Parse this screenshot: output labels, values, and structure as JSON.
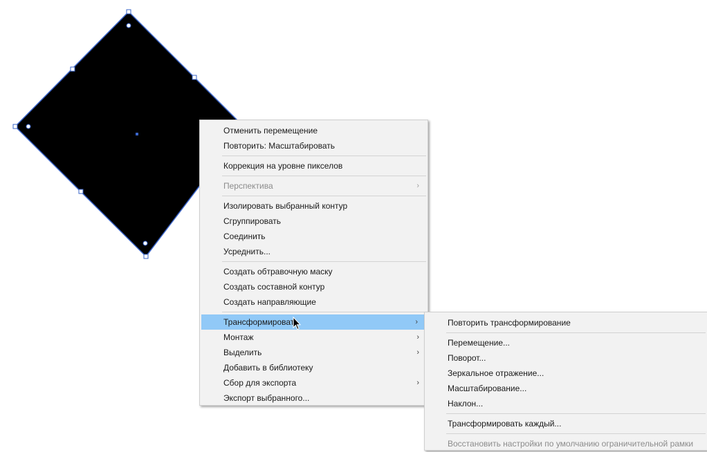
{
  "colors": {
    "artwork_fill": "#000000",
    "selection_stroke": "#3a64c8",
    "menu_background": "#f2f2f2",
    "menu_highlight": "#91c9f7",
    "disabled_text": "#8c8c8c"
  },
  "context_menu": {
    "groups": [
      [
        {
          "label": "Отменить перемещение",
          "enabled": true,
          "submenu": false
        },
        {
          "label": "Повторить: Масштабировать",
          "enabled": true,
          "submenu": false
        }
      ],
      [
        {
          "label": "Коррекция на уровне пикселов",
          "enabled": true,
          "submenu": false
        }
      ],
      [
        {
          "label": "Перспектива",
          "enabled": false,
          "submenu": true
        }
      ],
      [
        {
          "label": "Изолировать выбранный контур",
          "enabled": true,
          "submenu": false
        },
        {
          "label": "Сгруппировать",
          "enabled": true,
          "submenu": false
        },
        {
          "label": "Соединить",
          "enabled": true,
          "submenu": false
        },
        {
          "label": "Усреднить...",
          "enabled": true,
          "submenu": false
        }
      ],
      [
        {
          "label": "Создать обтравочную маску",
          "enabled": true,
          "submenu": false
        },
        {
          "label": "Создать составной контур",
          "enabled": true,
          "submenu": false
        },
        {
          "label": "Создать направляющие",
          "enabled": true,
          "submenu": false
        }
      ],
      [
        {
          "label": "Трансформировать",
          "enabled": true,
          "submenu": true,
          "highlighted": true
        },
        {
          "label": "Монтаж",
          "enabled": true,
          "submenu": true
        },
        {
          "label": "Выделить",
          "enabled": true,
          "submenu": true
        },
        {
          "label": "Добавить в библиотеку",
          "enabled": true,
          "submenu": false
        },
        {
          "label": "Сбор для экспорта",
          "enabled": true,
          "submenu": true
        },
        {
          "label": "Экспорт выбранного...",
          "enabled": true,
          "submenu": false
        }
      ]
    ]
  },
  "transform_submenu": {
    "groups": [
      [
        {
          "label": "Повторить трансформирование",
          "enabled": true
        }
      ],
      [
        {
          "label": "Перемещение...",
          "enabled": true
        },
        {
          "label": "Поворот...",
          "enabled": true
        },
        {
          "label": "Зеркальное отражение...",
          "enabled": true
        },
        {
          "label": "Масштабирование...",
          "enabled": true
        },
        {
          "label": "Наклон...",
          "enabled": true
        }
      ],
      [
        {
          "label": "Трансформировать каждый...",
          "enabled": true
        }
      ],
      [
        {
          "label": "Восстановить настройки по умолчанию ограничительной рамки",
          "enabled": false
        }
      ]
    ]
  },
  "icons": {
    "submenu_arrow": "chevron-right-icon",
    "cursor": "arrow-cursor-icon"
  }
}
